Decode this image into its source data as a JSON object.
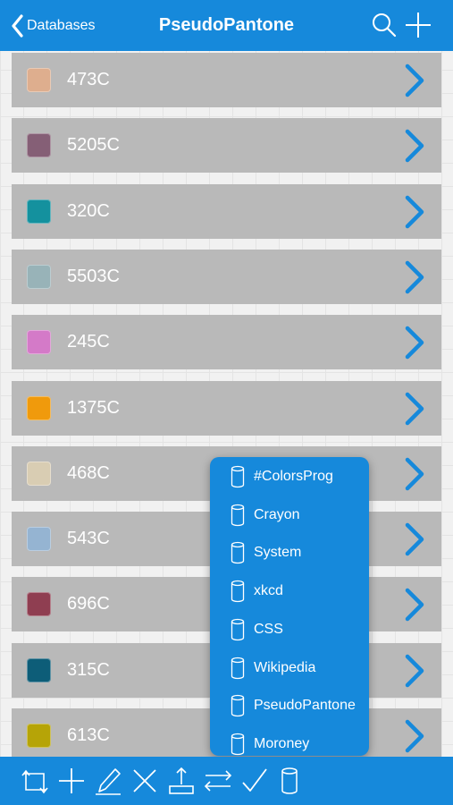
{
  "navbar": {
    "back_label": "Databases",
    "title": "PseudoPantone",
    "icons": [
      "search-icon",
      "add-icon"
    ]
  },
  "colors": [
    {
      "name": "473C",
      "hex": "#deae8e"
    },
    {
      "name": "5205C",
      "hex": "#855f76"
    },
    {
      "name": "320C",
      "hex": "#14919e"
    },
    {
      "name": "5503C",
      "hex": "#98b3b8"
    },
    {
      "name": "245C",
      "hex": "#d47ac8"
    },
    {
      "name": "1375C",
      "hex": "#f09a0c"
    },
    {
      "name": "468C",
      "hex": "#d9cdb3"
    },
    {
      "name": "543C",
      "hex": "#95b4d2"
    },
    {
      "name": "696C",
      "hex": "#8f3e51"
    },
    {
      "name": "315C",
      "hex": "#0d5d78"
    },
    {
      "name": "613C",
      "hex": "#b6a407"
    }
  ],
  "database_menu": {
    "items": [
      "#ColorsProg",
      "Crayon",
      "System",
      "xkcd",
      "CSS",
      "Wikipedia",
      "PseudoPantone",
      "Moroney"
    ]
  },
  "toolbar": {
    "icons": [
      "sync-icon",
      "add-icon",
      "edit-icon",
      "delete-icon",
      "export-icon",
      "swap-icon",
      "check-icon",
      "database-icon"
    ]
  },
  "theme": {
    "accent": "#1689db",
    "row_bg": "#b9b9b9"
  }
}
